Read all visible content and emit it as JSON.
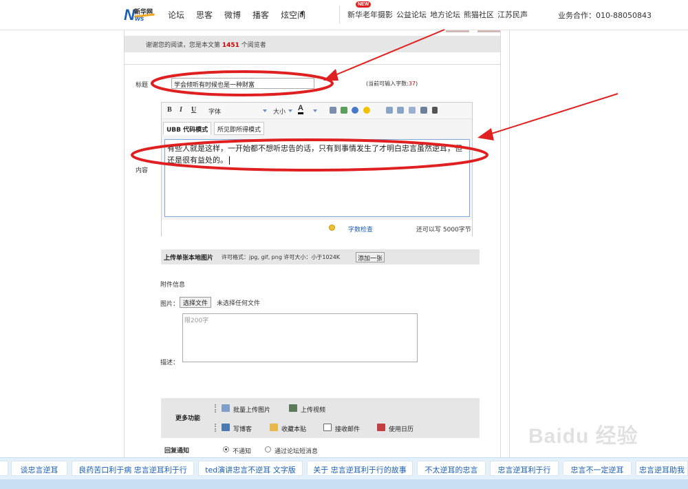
{
  "nav": {
    "logo_letters": "NEWS",
    "logo_cn": "新华网",
    "main_items": [
      "论坛",
      "思客",
      "微博",
      "播客",
      "炫空间"
    ],
    "new_badge": "NEW",
    "sub_items": [
      "新华老年摄影",
      "公益论坛",
      "地方论坛",
      "熊猫社区",
      "江苏民声"
    ],
    "business": "业务合作：010-88050843"
  },
  "thanks": {
    "prefix": "谢谢您的阅读，您是本文第 ",
    "count": "1451",
    "suffix": " 个阅览者"
  },
  "form": {
    "title_label": "标题",
    "title_value": "学会倾听有时候也是一种财富",
    "chars_prefix": "(当前可输入字数:",
    "chars_value": "37",
    "chars_suffix": ")",
    "content_label": "内容",
    "toolbar": {
      "bold": "B",
      "italic": "I",
      "underline": "U",
      "font": "字体",
      "size": "大小",
      "color": "A"
    },
    "modes": [
      "UBB 代码模式",
      "所见即所得模式"
    ],
    "content_text": "有些人就是这样，一开始都不想听忠告的话，只有到事情发生了才明白忠言虽然逆耳，但还是很有益处的。",
    "word_check": "字数检查",
    "remaining": "还可以写 5000字节"
  },
  "upload": {
    "title": "上传单张本地图片",
    "spec": "许可格式：jpg, gif, png 许可大小：小于1024K",
    "add_button": "添加一张",
    "attach_label": "附件信息",
    "image_label": "图片：",
    "choose_file": "选择文件",
    "no_file": "未选择任何文件",
    "desc_label": "描述：",
    "desc_placeholder": "限200字"
  },
  "more": {
    "title": "更多功能",
    "items": [
      "批量上传图片",
      "上传视频",
      "写博客",
      "收藏本贴",
      "接收邮件",
      "使用日历"
    ]
  },
  "reply": {
    "label": "回复通知",
    "options": [
      "不通知",
      "通过论坛短消息"
    ]
  },
  "bottom_tags": [
    "谈忠言逆耳",
    "良药苦口利于病 忠言逆耳利于行",
    "ted演讲忠言不逆耳 文字版",
    "关于 忠言逆耳利于行的故事",
    "不太逆耳的忠言",
    "忠言逆耳利于行",
    "忠言不一定逆耳",
    "忠言逆耳助我"
  ],
  "watermark": "Baidu 经验",
  "colors": {
    "annotation_red": "#e02020",
    "link_blue": "#1a5fb4",
    "bottom_bg": "#e4f0fa"
  }
}
